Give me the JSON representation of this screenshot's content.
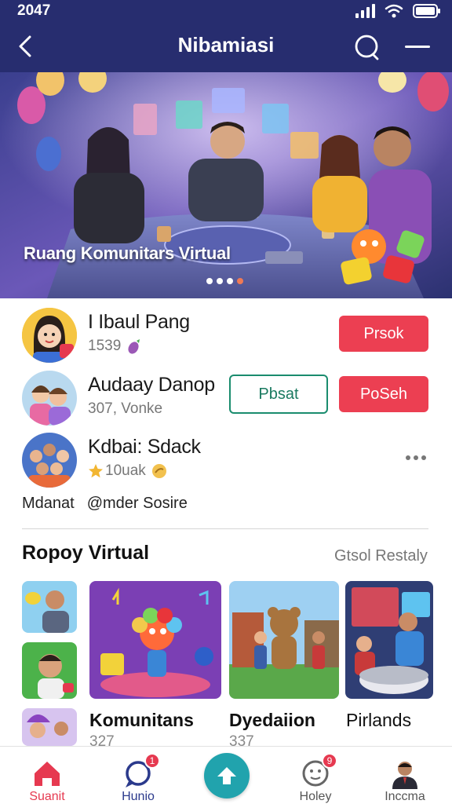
{
  "status_bar": {
    "time": "2047"
  },
  "header": {
    "title": "Nibamiasi"
  },
  "banner": {
    "caption": "Ruang Komunitars Virtual",
    "slides": 4,
    "active_slide": 4
  },
  "people": [
    {
      "name": "I Ibaul Pang",
      "sub": "1539",
      "sub_icon": "eggplant-icon",
      "actions": [
        {
          "label": "Prsok",
          "style": "filled-red"
        }
      ]
    },
    {
      "name": "Audaay Danop",
      "sub": "307, Vonke",
      "actions": [
        {
          "label": "Pbsat",
          "style": "outline-green"
        },
        {
          "label": "PoSeh",
          "style": "filled-red"
        }
      ]
    },
    {
      "name": "Kdbai: Sdack",
      "sub": "10uak",
      "sub_icon": "star-icon",
      "actions": []
    }
  ],
  "tags": [
    "Mdanat",
    "@mder Sosire"
  ],
  "section": {
    "title": "Ropoy Virtual",
    "link": "Gtsol Restaly"
  },
  "cards": [
    {
      "title": "Komunitans",
      "count": "327"
    },
    {
      "title": "Dyedaiion",
      "count": "337"
    },
    {
      "title": "Pirlands",
      "count": ""
    }
  ],
  "bottom_nav": [
    {
      "label": "Suanit",
      "icon": "home-icon",
      "active": true,
      "badge": ""
    },
    {
      "label": "Hunio",
      "icon": "chat-icon",
      "active": false,
      "badge": "1"
    },
    {
      "label": "",
      "icon": "upload-arrow-icon",
      "active": false,
      "badge": ""
    },
    {
      "label": "Holey",
      "icon": "face-icon",
      "active": false,
      "badge": "9"
    },
    {
      "label": "Inccma",
      "icon": "profile-avatar",
      "active": false,
      "badge": ""
    }
  ],
  "colors": {
    "header_bg": "#272d6f",
    "accent_red": "#ec3f52",
    "accent_green": "#1a8c6e",
    "fab_teal": "#21a3ad"
  }
}
